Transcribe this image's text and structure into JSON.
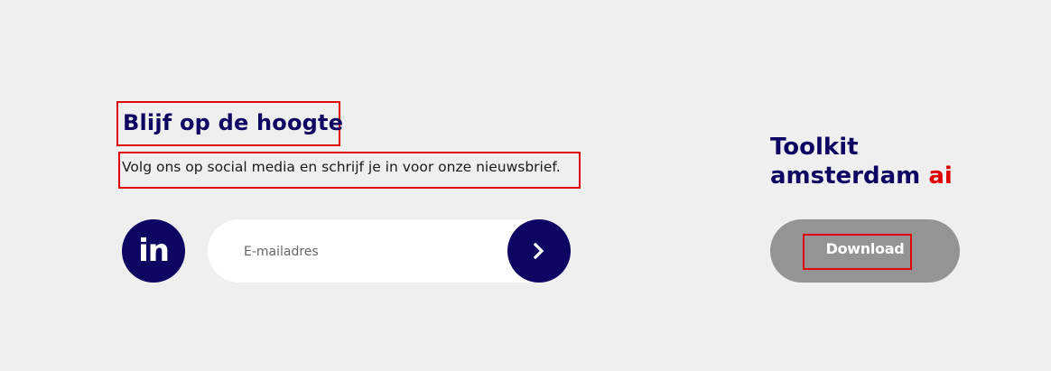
{
  "newsletter_section": {
    "heading": "Blijf op de hoogte",
    "subtitle": "Volg ons op social media en schrijf je in voor onze nieuwsbrief.",
    "linkedin_icon_text": "in",
    "email_placeholder": "E-mailadres",
    "submit_icon": "chevron-right-icon"
  },
  "toolkit": {
    "line1": "Toolkit",
    "line2": "amsterdam",
    "accent": "ai",
    "download_label": "Download"
  },
  "colors": {
    "primary": "#0e0562",
    "accent": "#e10000",
    "button_grey": "#949494",
    "background": "#efefef"
  }
}
